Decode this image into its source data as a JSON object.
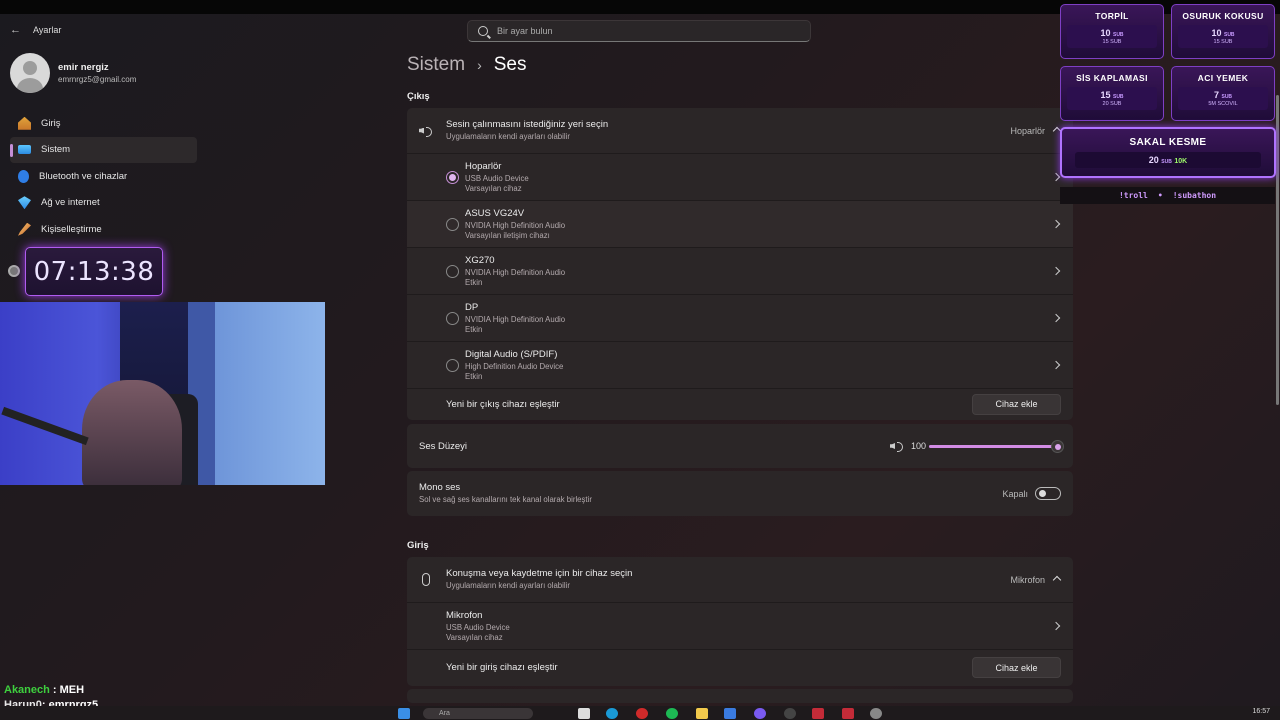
{
  "window": {
    "app_title": "Ayarlar"
  },
  "search": {
    "placeholder": "Bir ayar bulun"
  },
  "profile": {
    "name": "emir nergiz",
    "email": "emrnrgz5@gmail.com"
  },
  "sidebar": {
    "items": [
      {
        "label": "Giriş",
        "icon": "home-icon",
        "active": false
      },
      {
        "label": "Sistem",
        "icon": "system-icon",
        "active": true
      },
      {
        "label": "Bluetooth ve cihazlar",
        "icon": "bluetooth-icon",
        "active": false
      },
      {
        "label": "Ağ ve internet",
        "icon": "network-icon",
        "active": false
      },
      {
        "label": "Kişiselleştirme",
        "icon": "brush-icon",
        "active": false
      }
    ]
  },
  "overlay": {
    "timer": "07:13:38",
    "chat": [
      {
        "user": "Akanech",
        "message": "MEH"
      },
      {
        "user": "Harun0",
        "message": "emrnrgz5"
      }
    ],
    "donations": [
      {
        "title": "TORPİL",
        "amount": "10",
        "unit": "SUB",
        "sub": "15 SUB"
      },
      {
        "title": "OSURUK KOKUSU",
        "amount": "10",
        "unit": "SUB",
        "sub": "15 SUB"
      },
      {
        "title": "SİS KAPLAMASI",
        "amount": "15",
        "unit": "SUB",
        "sub": "20 SUB"
      },
      {
        "title": "ACI YEMEK",
        "amount": "7",
        "unit": "SUB",
        "sub": "5M SCOVIL"
      },
      {
        "title": "SAKAL KESME",
        "amount": "20",
        "unit": "SUB",
        "sub": "10K"
      }
    ],
    "commands": [
      "!troll",
      "•",
      "!subathon"
    ]
  },
  "breadcrumb": {
    "parent": "Sistem",
    "separator": "›",
    "current": "Ses"
  },
  "output": {
    "section_title": "Çıkış",
    "header": {
      "title": "Sesin çalınmasını istediğiniz yeri seçin",
      "subtitle": "Uygulamaların kendi ayarları olabilir",
      "value": "Hoparlör"
    },
    "devices": [
      {
        "name": "Hoparlör",
        "line1": "USB Audio Device",
        "line2": "Varsayılan cihaz",
        "selected": true
      },
      {
        "name": "ASUS VG24V",
        "line1": "NVIDIA High Definition Audio",
        "line2": "Varsayılan iletişim cihazı",
        "selected": false
      },
      {
        "name": "XG270",
        "line1": "NVIDIA High Definition Audio",
        "line2": "Etkin",
        "selected": false
      },
      {
        "name": "DP",
        "line1": "NVIDIA High Definition Audio",
        "line2": "Etkin",
        "selected": false
      },
      {
        "name": "Digital Audio (S/PDIF)",
        "line1": "High Definition Audio Device",
        "line2": "Etkin",
        "selected": false
      }
    ],
    "pair_label": "Yeni bir çıkış cihazı eşleştir",
    "add_button": "Cihaz ekle"
  },
  "volume": {
    "label": "Ses Düzeyi",
    "value": "100",
    "level": 1.0
  },
  "mono": {
    "title": "Mono ses",
    "subtitle": "Sol ve sağ ses kanallarını tek kanal olarak birleştir",
    "state": "Kapalı"
  },
  "input": {
    "section_title": "Giriş",
    "header": {
      "title": "Konuşma veya kaydetme için bir cihaz seçin",
      "subtitle": "Uygulamaların kendi ayarları olabilir",
      "value": "Mikrofon"
    },
    "devices": [
      {
        "name": "Mikrofon",
        "line1": "USB Audio Device",
        "line2": "Varsayılan cihaz"
      }
    ],
    "pair_label": "Yeni bir giriş cihazı eşleştir",
    "add_button": "Cihaz ekle"
  },
  "taskbar": {
    "search_placeholder": "Ara",
    "clock": "16:57"
  },
  "colors": {
    "accent": "#c58fd6",
    "background": "#221b1e",
    "card": "#2b2627",
    "overlay_purple": "#7e3fc4"
  }
}
